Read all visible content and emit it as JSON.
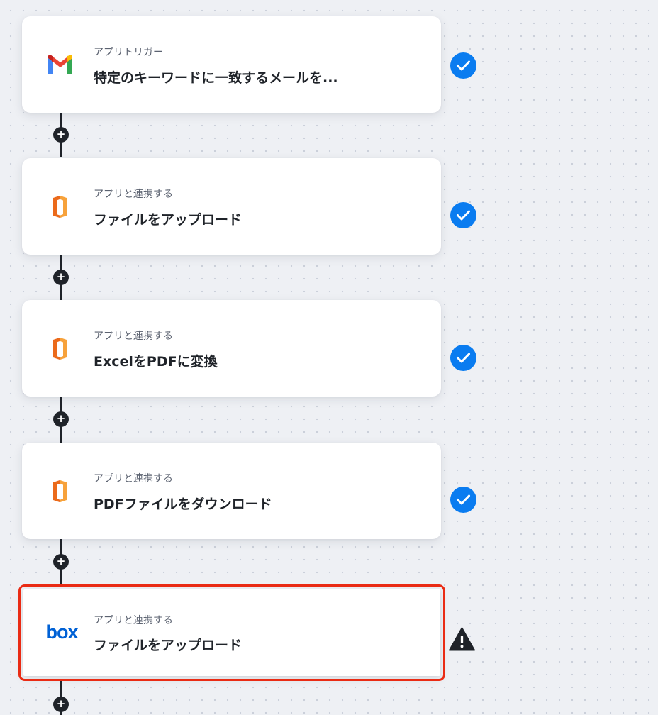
{
  "flow": {
    "steps": [
      {
        "subtitle": "アプリトリガー",
        "title": "特定のキーワードに一致するメールを...",
        "app_icon": "gmail-icon",
        "status": "complete"
      },
      {
        "subtitle": "アプリと連携する",
        "title": "ファイルをアップロード",
        "app_icon": "office-document-icon",
        "status": "complete"
      },
      {
        "subtitle": "アプリと連携する",
        "title": "ExcelをPDFに変換",
        "app_icon": "office-document-icon",
        "status": "complete"
      },
      {
        "subtitle": "アプリと連携する",
        "title": "PDFファイルをダウンロード",
        "app_icon": "office-document-icon",
        "status": "complete"
      },
      {
        "subtitle": "アプリと連携する",
        "title": "ファイルをアップロード",
        "app_icon": "box-logo-icon",
        "status": "warning",
        "selected": true
      }
    ],
    "box_logo_text": "box",
    "add_step_symbol": "+"
  },
  "colors": {
    "check": "#0a7cf0",
    "warning": "#1f2329",
    "selected_outline": "#ea2b14",
    "office_orange": "#eb6a1b"
  }
}
